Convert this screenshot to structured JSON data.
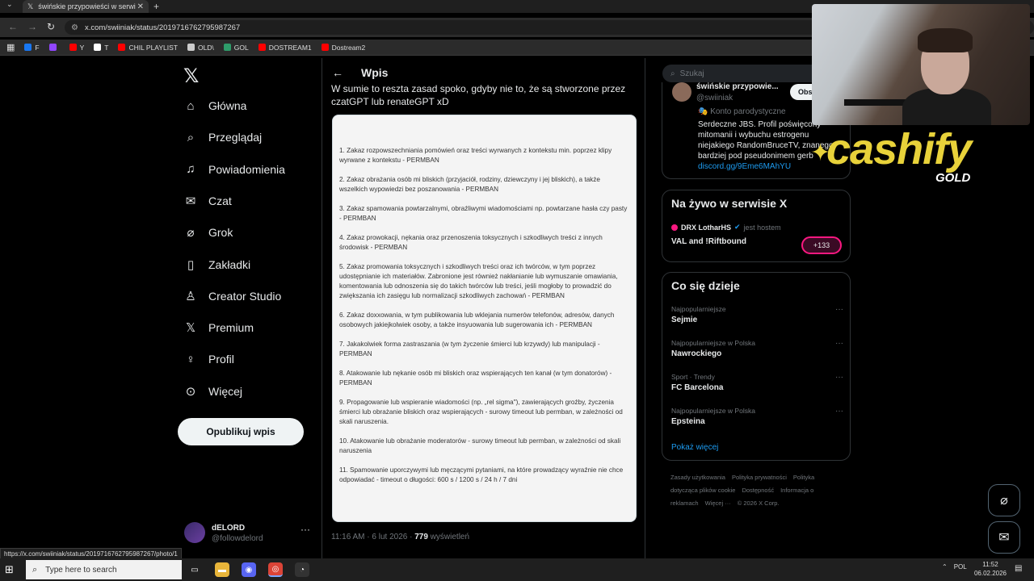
{
  "browser": {
    "tab_title": "świńskie przypowieści w serwi",
    "url": "x.com/swiiniak/status/2019716762795987267",
    "bookmarks": [
      {
        "label": "F",
        "color": "#1877f2"
      },
      {
        "label": "",
        "color": "#9146ff"
      },
      {
        "label": "Y",
        "color": "#ff0000"
      },
      {
        "label": "T",
        "color": "#ffffff"
      },
      {
        "label": "CHIL PLAYLIST",
        "color": "#ff0000"
      },
      {
        "label": "OLD\\",
        "color": "#cccccc"
      },
      {
        "label": "GOL",
        "color": "#2e9c6a"
      },
      {
        "label": "DOSTREAM1",
        "color": "#ff0000"
      },
      {
        "label": "Dostream2",
        "color": "#ff0000"
      }
    ],
    "status_url": "https://x.com/swiiniak/status/2019716762795987267/photo/1"
  },
  "nav": {
    "items": [
      {
        "label": "Główna",
        "icon": "home-icon"
      },
      {
        "label": "Przeglądaj",
        "icon": "search-icon"
      },
      {
        "label": "Powiadomienia",
        "icon": "bell-icon"
      },
      {
        "label": "Czat",
        "icon": "mail-icon"
      },
      {
        "label": "Grok",
        "icon": "grok-icon"
      },
      {
        "label": "Zakładki",
        "icon": "bookmark-icon"
      },
      {
        "label": "Creator Studio",
        "icon": "creator-icon"
      },
      {
        "label": "Premium",
        "icon": "x-icon"
      },
      {
        "label": "Profil",
        "icon": "person-icon"
      },
      {
        "label": "Więcej",
        "icon": "more-circle-icon"
      }
    ],
    "post_button": "Opublikuj wpis",
    "account_name": "dELORD",
    "account_handle": "@followdelord"
  },
  "post": {
    "header": "Wpis",
    "text": "W sumie to reszta zasad spoko, gdyby nie to, że są stworzone przez czatGPT lub renateGPT xD",
    "rules": [
      "1. Zakaz rozpowszechniania pomówień oraz treści wyrwanych z kontekstu min. poprzez klipy wyrwane z kontekstu - PERMBAN",
      "2. Zakaz obrażania osób mi bliskich (przyjaciół, rodziny, dziewczyny i jej bliskich), a także wszelkich wypowiedzi bez poszanowania - PERMBAN",
      "3. Zakaz spamowania powtarzalnymi, obraźliwymi wiadomościami np. powtarzane hasła czy pasty - PERMBAN",
      "4. Zakaz prowokacji, nękania oraz przenoszenia toksycznych i szkodliwych treści z innych środowisk - PERMBAN",
      "5. Zakaz promowania toksycznych i szkodliwych treści oraz ich twórców, w tym poprzez udostępnianie ich materiałów. Zabronione jest również nakłanianie lub wymuszanie omawiania, komentowania lub odnoszenia się do takich twórców lub treści, jeśli mogłoby to prowadzić do zwiększania ich zasięgu lub normalizacji szkodliwych zachowań - PERMBAN",
      "6. Zakaz doxxowania, w tym publikowania lub wklejania numerów telefonów, adresów, danych osobowych jakiejkolwiek osoby, a także insyuowania lub sugerowania ich - PERMBAN",
      "7. Jakakolwiek forma zastraszania (w tym życzenie śmierci lub krzywdy)  lub manipulacji - PERMBAN",
      "8. Atakowanie lub nękanie osób mi bliskich oraz wspierających ten kanał (w tym donatorów) - PERMBAN",
      "9. Propagowanie lub wspieranie wiadomości (np. „rel sigma\"), zawierających groźby, życzenia śmierci lub obrażanie bliskich oraz wspierających - surowy timeout lub permban, w zależności od skali naruszenia.",
      "10. Atakowanie lub obrażanie moderatorów - surowy timeout lub permban, w zależności od skali naruszenia",
      "11. Spamowanie uporczywymi lub męczącymi pytaniami, na które prowadzący wyraźnie nie chce odpowiadać - timeout o długości: 600 s / 1200 s / 24 h / 7 dni"
    ],
    "time": "11:16 AM · 6 lut 2026 · ",
    "views": "779",
    "views_label": " wyświetleń"
  },
  "sidebar": {
    "search_placeholder": "Szukaj",
    "profile_name": "świńskie przypowie...",
    "profile_handle": "@swiiniak",
    "follow_label": "Obs",
    "parody_label": "Konto parodystyczne",
    "bio": "Serdeczne JBS. Profil poświęcony mitomanii i wybuchu estrogenu niejakiego RandomBruceTV, znanego bardziej pod pseudonimem gerb",
    "bio_link": "discord.gg/9Eme6MAhYU",
    "live_title": "Na żywo w serwisie X",
    "live_host": "DRX LotharHS",
    "live_host_label": "jest hostem",
    "live_stream": "VAL and !Riftbound",
    "live_count": "+133",
    "trends_title": "Co się dzieje",
    "trends": [
      {
        "category": "Najpopularniejsze",
        "name": "Sejmie"
      },
      {
        "category": "Najpopularniejsze w Polska",
        "name": "Nawrockiego"
      },
      {
        "category": "Sport · Trendy",
        "name": "FC Barcelona"
      },
      {
        "category": "Najpopularniejsze w Polska",
        "name": "Epsteina"
      }
    ],
    "show_more": "Pokaż więcej",
    "footer_links": [
      "Zasady użytkowania",
      "Polityka prywatności",
      "Polityka dotycząca plików cookie",
      "Dostępność",
      "Informacja o reklamach",
      "Więcej ···",
      "© 2026 X Corp."
    ]
  },
  "overlay": {
    "brand": "cashify",
    "brand_sub": "GOLD"
  },
  "taskbar": {
    "search_placeholder": "Type here to search",
    "lang": "POL",
    "time": "11:52",
    "date": "06.02.2026"
  }
}
